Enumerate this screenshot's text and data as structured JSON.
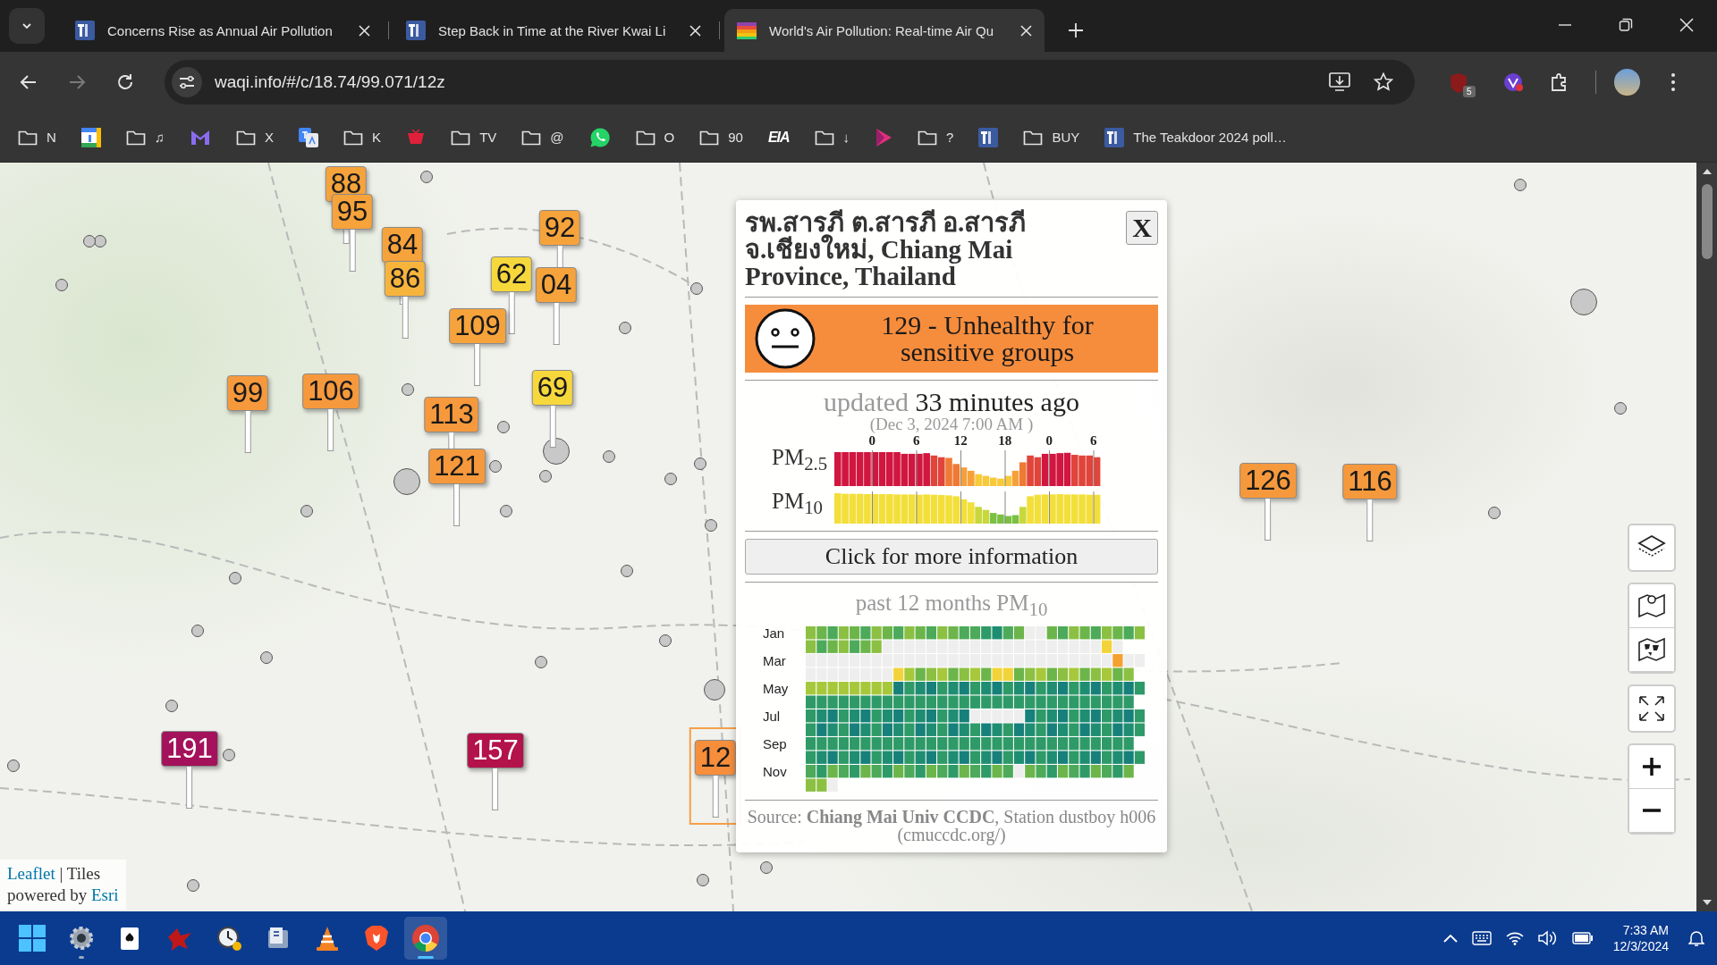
{
  "tabs": [
    {
      "title": "Concerns Rise as Annual Air Pollution",
      "kind": "teakdoor",
      "selected": false
    },
    {
      "title": "Step Back in Time at the River Kwai Li",
      "kind": "teakdoor",
      "selected": false
    },
    {
      "title": "World's Air Pollution: Real-time Air Qu",
      "kind": "waqi",
      "selected": true
    }
  ],
  "toolbar": {
    "back_disabled": false,
    "forward_disabled": true,
    "url": "waqi.info/#/c/18.74/99.071/12z",
    "extension_badge": "5"
  },
  "bookmarks": [
    {
      "kind": "folder",
      "label": "N"
    },
    {
      "kind": "calendar"
    },
    {
      "kind": "folder",
      "label": "♫"
    },
    {
      "kind": "mail"
    },
    {
      "kind": "folder",
      "label": "X"
    },
    {
      "kind": "translate"
    },
    {
      "kind": "folder",
      "label": "K"
    },
    {
      "kind": "tv"
    },
    {
      "kind": "folder",
      "label": "TV"
    },
    {
      "kind": "folder",
      "label": "@"
    },
    {
      "kind": "chat"
    },
    {
      "kind": "folder",
      "label": "O"
    },
    {
      "kind": "folder",
      "label": "90"
    },
    {
      "kind": "logo",
      "label": "EIA"
    },
    {
      "kind": "folder",
      "label": "↓"
    },
    {
      "kind": "play"
    },
    {
      "kind": "folder",
      "label": "?"
    },
    {
      "kind": "teakdoor"
    },
    {
      "kind": "folder",
      "label": "BUY"
    },
    {
      "kind": "site",
      "label": "The Teakdoor 2024 poll…"
    }
  ],
  "map": {
    "markers": [
      {
        "value": "88",
        "color": "#f6a33c",
        "selected": false
      },
      {
        "value": "95",
        "color": "#f6a33c",
        "selected": false
      },
      {
        "value": "84",
        "color": "#f6a33c",
        "selected": false
      },
      {
        "value": "92",
        "color": "#f6a33c",
        "selected": false
      },
      {
        "value": "86",
        "color": "#f7b43c",
        "selected": false
      },
      {
        "value": "04",
        "color": "#f6a33c",
        "selected": false
      },
      {
        "value": "62",
        "color": "#f7d83c",
        "selected": false
      },
      {
        "value": "109",
        "color": "#f6a33c",
        "selected": false
      },
      {
        "value": "99",
        "color": "#f6993c",
        "selected": false
      },
      {
        "value": "106",
        "color": "#f6993c",
        "selected": false
      },
      {
        "value": "113",
        "color": "#f6993c",
        "selected": false
      },
      {
        "value": "121",
        "color": "#f6993c",
        "selected": false
      },
      {
        "value": "69",
        "color": "#f7d83c",
        "selected": false
      },
      {
        "value": "191",
        "color": "#a3125a",
        "selected": false
      },
      {
        "value": "157",
        "color": "#b3124a",
        "selected": false
      },
      {
        "value": "12",
        "color": "#f68e3c",
        "selected": true
      },
      {
        "value": "126",
        "color": "#f6993c",
        "selected": false
      },
      {
        "value": "116",
        "color": "#f6993c",
        "selected": false
      }
    ],
    "attribution": {
      "leaflet": "Leaflet",
      "separator": "|",
      "tiles": "Tiles",
      "powered_by": "powered by",
      "esri": "Esri"
    }
  },
  "popup": {
    "title": "รพ.สารภี ต.สารภี อ.สารภี จ.เชียงใหม่, Chiang Mai Province, Thailand",
    "close": "X",
    "aqi_text": "129 - Unhealthy for sensitive groups",
    "updated_label": "updated",
    "updated_value": "33 minutes ago",
    "timestamp": "(Dec 3, 2024 7:00 AM )",
    "hour_ticks": [
      "0",
      "6",
      "12",
      "18",
      "0",
      "6"
    ],
    "series_labels": [
      "PM$_{2.5}$",
      "PM$_{10}$"
    ],
    "more_button": "Click for more information",
    "history_title": "past 12 months PM$_{10}$",
    "months": [
      "Jan",
      "Mar",
      "May",
      "Jul",
      "Sep",
      "Nov"
    ],
    "source": "Source: **Chiang Mai Univ CCDC**, Station dustboy h006 (cmuccdc.org/)"
  },
  "taskbar": {
    "apps": [
      {
        "kind": "start",
        "running": false,
        "selected": false
      },
      {
        "kind": "settings",
        "running": true,
        "selected": false
      },
      {
        "kind": "cards",
        "running": false,
        "selected": false
      },
      {
        "kind": "bird",
        "running": false,
        "selected": false
      },
      {
        "kind": "clock",
        "running": false,
        "selected": false
      },
      {
        "kind": "archive",
        "running": false,
        "selected": false
      },
      {
        "kind": "cone",
        "running": false,
        "selected": false
      },
      {
        "kind": "lion",
        "running": false,
        "selected": false
      },
      {
        "kind": "browser",
        "running": true,
        "selected": true
      }
    ],
    "time": "7:33 AM",
    "date": "12/3/2024"
  }
}
